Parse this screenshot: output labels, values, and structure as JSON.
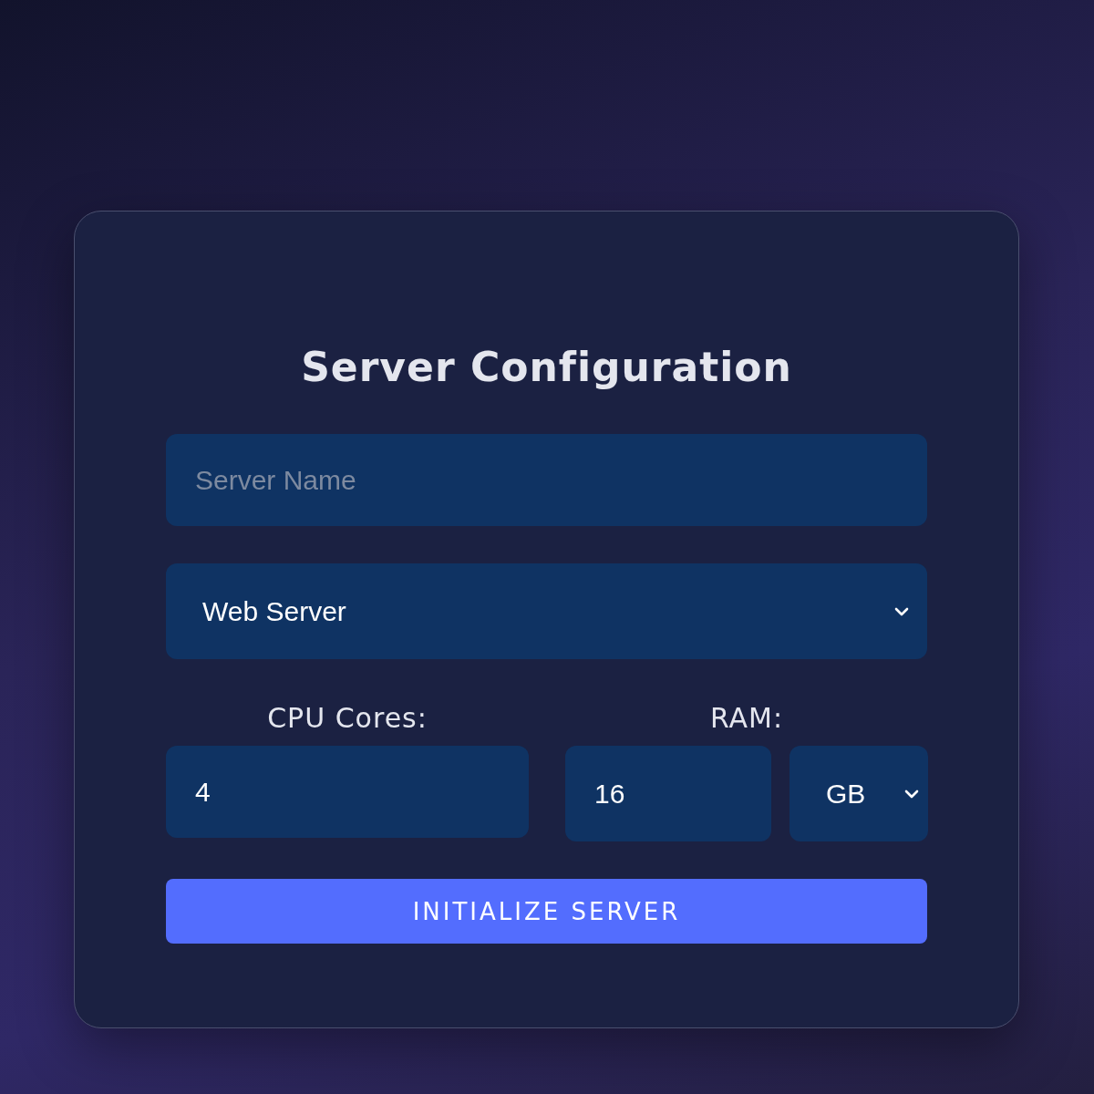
{
  "title": "Server Configuration",
  "server_name": {
    "placeholder": "Server Name"
  },
  "server_type": {
    "value": "Web Server"
  },
  "cpu": {
    "label": "CPU Cores:",
    "value": "4"
  },
  "ram": {
    "label": "RAM:",
    "value": "16",
    "unit": "GB"
  },
  "button": "INITIALIZE SERVER"
}
